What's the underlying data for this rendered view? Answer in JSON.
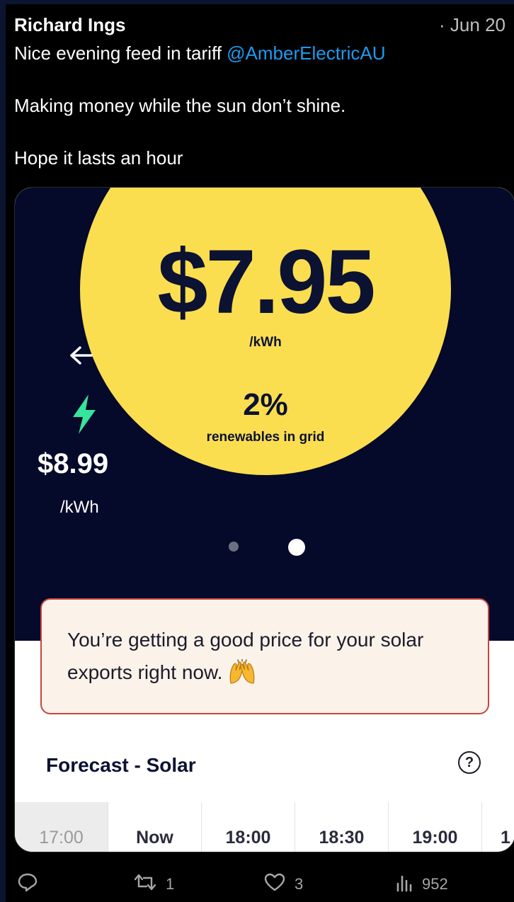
{
  "tweet": {
    "author": "Richard Ings",
    "date": "· Jun 20",
    "line1_text": "Nice evening feed in tariff ",
    "line1_mention": "@AmberElectricAU",
    "line2": "Making money while the sun don’t shine.",
    "line3": "Hope it lasts an hour"
  },
  "card": {
    "export_price": "$7.95",
    "export_unit": "/kWh",
    "renewables_pct": "2%",
    "renewables_label": "renewables in grid",
    "import_price": "$8.99",
    "import_unit": "/kWh",
    "notice_line1": "You’re getting a good price for your solar",
    "notice_line2": "exports right now.",
    "forecast_title": "Forecast - Solar",
    "help_symbol": "?",
    "times": [
      "17:00",
      "Now",
      "18:00",
      "18:30",
      "19:00",
      "1"
    ]
  },
  "actions": {
    "retweets": "1",
    "likes": "3",
    "views": "952"
  },
  "colors": {
    "sun": "#fbde4f",
    "card_dark": "#05092a",
    "bolt": "#35e59b",
    "mention": "#1d9bf0",
    "notice_border": "#c9453f"
  },
  "icons": [
    "back-arrow-icon",
    "lightning-bolt-icon",
    "raising-hands-emoji-icon",
    "question-mark-icon",
    "reply-icon",
    "retweet-icon",
    "like-icon",
    "views-icon"
  ]
}
